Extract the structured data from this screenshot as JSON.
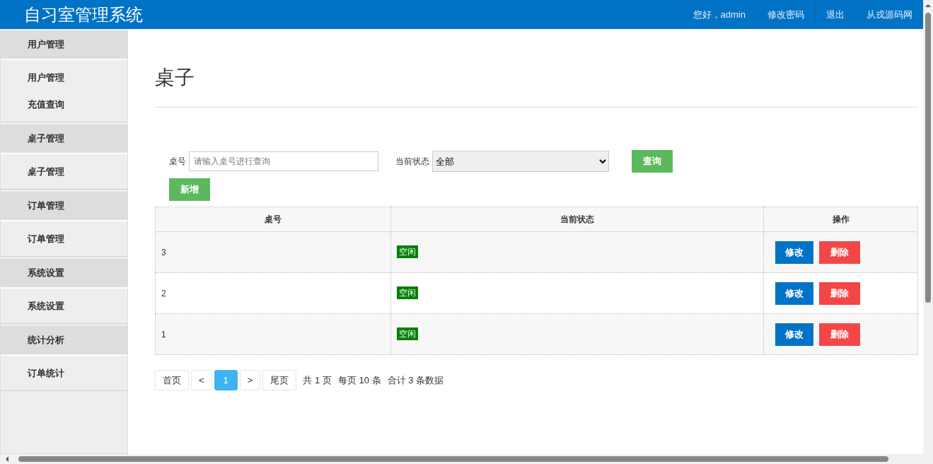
{
  "header": {
    "title": "自习室管理系统",
    "links": [
      "您好，admin",
      "修改密码",
      "退出",
      "从戎源码网"
    ]
  },
  "sidebar": {
    "groups": [
      {
        "title": "用户管理",
        "items": [
          "用户管理",
          "充值查询"
        ]
      },
      {
        "title": "桌子管理",
        "items": [
          "桌子管理"
        ]
      },
      {
        "title": "订单管理",
        "items": [
          "订单管理"
        ]
      },
      {
        "title": "系统设置",
        "items": [
          "系统设置"
        ]
      },
      {
        "title": "统计分析",
        "items": [
          "订单统计"
        ]
      }
    ]
  },
  "page": {
    "heading": "桌子"
  },
  "filters": {
    "number_label": "桌号",
    "number_placeholder": "请输入桌号进行查询",
    "status_label": "当前状态",
    "status_value": "全部",
    "search_button": "查询",
    "add_button": "新增"
  },
  "table": {
    "columns": [
      "桌号",
      "当前状态",
      "操作"
    ],
    "rows": [
      {
        "number": "3",
        "status": "空闲",
        "actions": [
          "修改",
          "删除"
        ]
      },
      {
        "number": "2",
        "status": "空闲",
        "actions": [
          "修改",
          "删除"
        ]
      },
      {
        "number": "1",
        "status": "空闲",
        "actions": [
          "修改",
          "删除"
        ]
      }
    ]
  },
  "pagination": {
    "first": "首页",
    "prev": "<",
    "pages": [
      {
        "label": "1",
        "selected": true
      }
    ],
    "next": ">",
    "last": "尾页",
    "info": [
      "共 1 页",
      "每页 10 条",
      "合计 3 条数据"
    ]
  }
}
